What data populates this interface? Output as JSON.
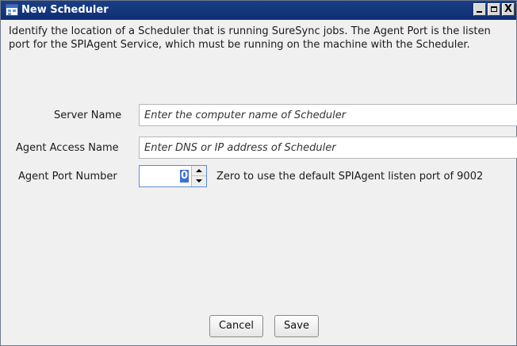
{
  "window": {
    "title": "New Scheduler",
    "close_glyph": "X"
  },
  "intro_text": "Identify the location of a Scheduler that is running SureSync jobs. The Agent Port is the listen port for the SPIAgent Service, which must be running on the machine with the Scheduler.",
  "form": {
    "server_name": {
      "label": "Server Name",
      "value": "",
      "placeholder": "Enter the computer name of Scheduler"
    },
    "agent_access_name": {
      "label": "Agent Access Name",
      "value": "",
      "placeholder": "Enter DNS or IP address of Scheduler"
    },
    "agent_port_number": {
      "label": "Agent Port Number",
      "value": "0",
      "hint": "Zero to use the default SPIAgent listen port of 9002"
    }
  },
  "buttons": {
    "cancel": "Cancel",
    "save": "Save"
  },
  "icons": [
    "scheduler-window-icon",
    "minimize-icon",
    "maximize-icon",
    "close-icon",
    "spin-up-icon",
    "spin-down-icon"
  ],
  "colors": {
    "title_bar": "#0f2e73",
    "selection": "#3d6fd8",
    "dialog_background": "#f0f0f0"
  }
}
